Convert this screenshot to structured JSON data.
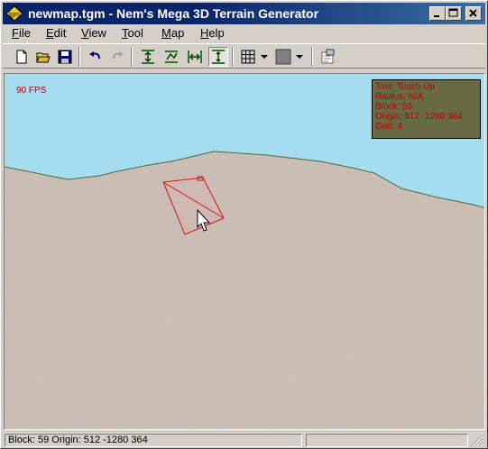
{
  "window": {
    "title": "newmap.tgm - Nem's Mega 3D Terrain Generator"
  },
  "titlebar_buttons": [
    "minimize",
    "maximize",
    "close"
  ],
  "menu": [
    {
      "label": "File",
      "mnemonic": "F",
      "rest": "ile"
    },
    {
      "label": "Edit",
      "mnemonic": "E",
      "rest": "dit"
    },
    {
      "label": "View",
      "mnemonic": "V",
      "rest": "iew"
    },
    {
      "label": "Tool",
      "mnemonic": "T",
      "rest": "ool"
    },
    {
      "label": "Map",
      "mnemonic": "M",
      "rest": "ap"
    },
    {
      "label": "Help",
      "mnemonic": "H",
      "rest": "elp"
    }
  ],
  "toolbar": {
    "buttons": [
      "new-icon",
      "open-icon",
      "save-icon",
      "undo-icon",
      "redo-icon",
      "raise-tool-icon",
      "smooth-tool-icon",
      "flatten-tool-icon",
      "touch-up-tool-icon",
      "grid-icon",
      "color-swatch-icon",
      "properties-icon"
    ],
    "pressed": "touch-up-tool-icon",
    "swatch_color": "#808080"
  },
  "viewport": {
    "fps": "90 FPS",
    "sky_color": "#a6dcf0",
    "info": {
      "tool": "Tool: Touch Up",
      "radius": "Radius: N/A",
      "block": "Block: 59",
      "origin": "Origin: 512 -1280 364",
      "grid": "Grid: 4"
    },
    "info_text_color": "#c00000"
  },
  "status": {
    "text": "Block: 59 Origin: 512 -1280 364"
  }
}
